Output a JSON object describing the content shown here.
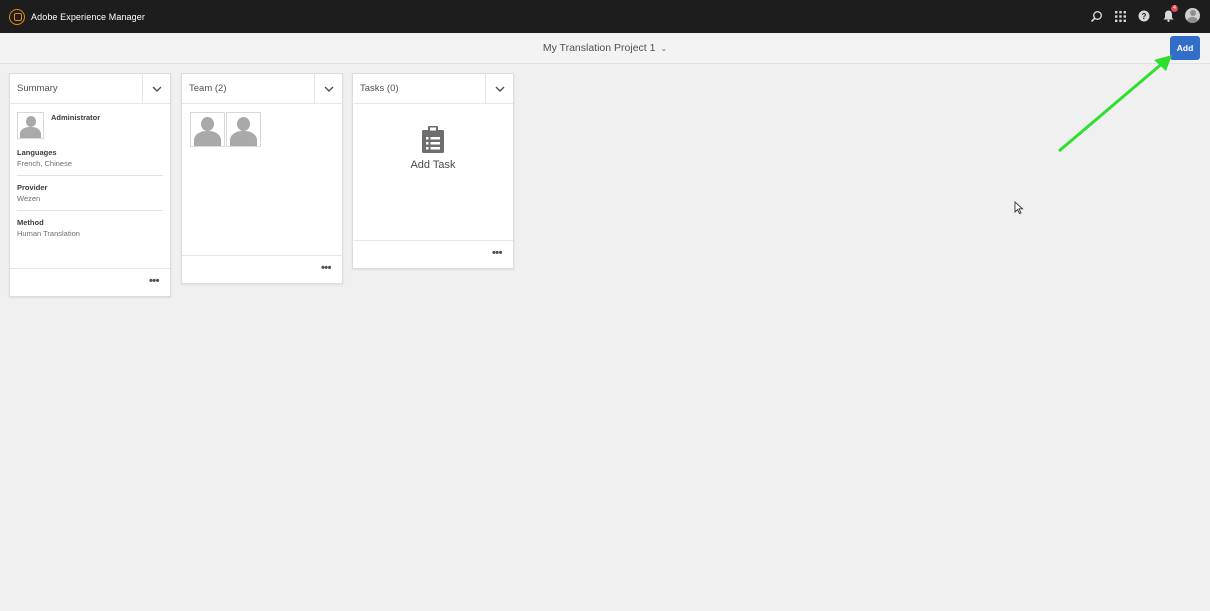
{
  "shell": {
    "app_name": "Adobe Experience Manager",
    "icons": [
      "search-icon",
      "apps-grid-icon",
      "help-icon",
      "notifications-icon",
      "user-avatar"
    ],
    "notification_count": "4"
  },
  "actionbar": {
    "project_title": "My Translation Project 1",
    "title_chevron": "⌄",
    "add_label": "Add"
  },
  "summary": {
    "title": "Summary",
    "owner": "Administrator",
    "sections": [
      {
        "label": "Languages",
        "value": "French, Chinese"
      },
      {
        "label": "Provider",
        "value": "Wezen"
      },
      {
        "label": "Method",
        "value": "Human Translation"
      }
    ],
    "more": "•••"
  },
  "team": {
    "title": "Team (2)",
    "more": "•••"
  },
  "tasks": {
    "title": "Tasks (0)",
    "add_task_label": "Add Task",
    "more": "•••"
  },
  "colors": {
    "shell_bg": "#1d1d1d",
    "accent": "#326ec8",
    "annotation_arrow": "#2ee02e"
  }
}
